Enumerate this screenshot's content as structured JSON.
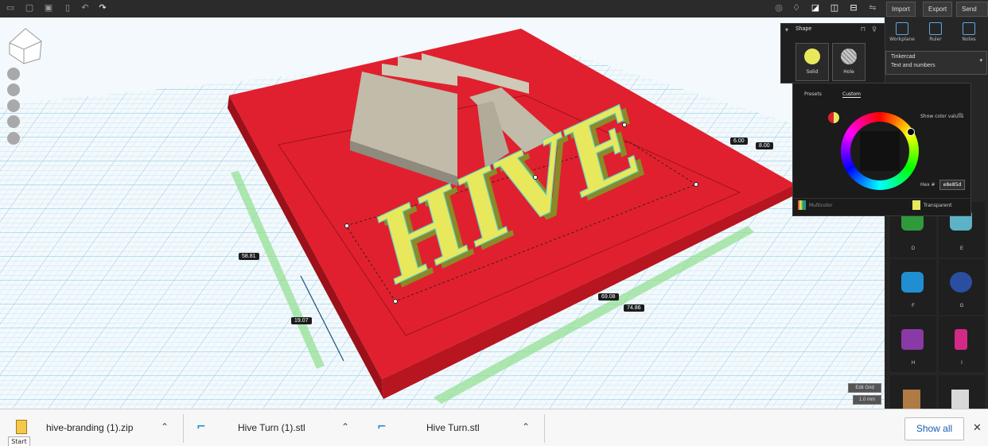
{
  "toolbar": {
    "import_label": "Import",
    "export_label": "Export",
    "send_to_label": "Send To",
    "undo_icon": "undo-icon",
    "redo_icon": "redo-icon"
  },
  "viewport": {
    "logo_text": "HIVE",
    "dimensions": {
      "d1": "58.81",
      "d2": "19.07",
      "d3": "69.08",
      "d4": "74.86",
      "d5": "6.00",
      "d6": "8.00"
    },
    "fit_button": "Edit Grid",
    "snap_button": "1.0 mm"
  },
  "shape_panel": {
    "title": "Shape",
    "solid_label": "Solid",
    "hole_label": "Hole"
  },
  "color_popup": {
    "tab_presets": "Presets",
    "tab_custom": "Custom",
    "show_color_values": "Show color values",
    "hex_label": "Hex #",
    "hex_value": "e8e85d",
    "multicolor_label": "Multicolor",
    "transparent_label": "Transparent",
    "selected_color": "#e8e85d"
  },
  "right_panel": {
    "tabs": [
      "Workplane",
      "Ruler",
      "Notes"
    ],
    "library_title": "Tinkercad",
    "library_subtitle": "Text and numbers",
    "letters": [
      {
        "label": "D",
        "color": "#2e9a3c"
      },
      {
        "label": "E",
        "color": "#5cb2c7"
      },
      {
        "label": "F",
        "color": "#1f8fd1"
      },
      {
        "label": "G",
        "color": "#2a4fa1"
      },
      {
        "label": "H",
        "color": "#8a3aa6"
      },
      {
        "label": "I",
        "color": "#d22a86"
      }
    ]
  },
  "downloads": {
    "items": [
      {
        "name": "hive-branding (1).zip"
      },
      {
        "name": "Hive Turn (1).stl"
      },
      {
        "name": "Hive Turn.stl"
      }
    ],
    "show_all": "Show all",
    "start_label": "Start"
  },
  "colors": {
    "plate": "#e0202e",
    "letters": "#e8e85d",
    "logo": "#c1bba9",
    "grid": "#a9d3ea",
    "accent": "#5aa9e6"
  }
}
